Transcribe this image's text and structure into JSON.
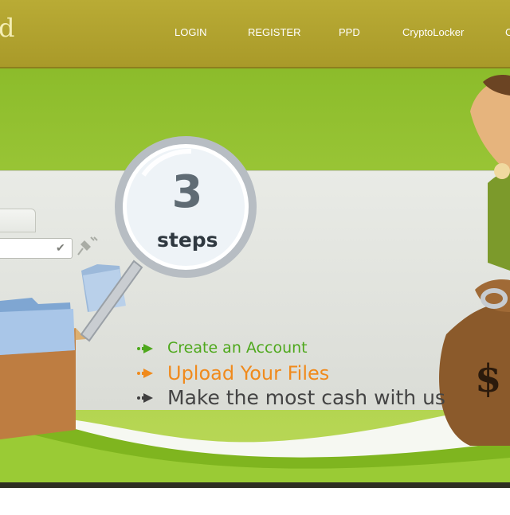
{
  "header": {
    "logo_text": "d",
    "nav": [
      {
        "label": "LOGIN"
      },
      {
        "label": "REGISTER"
      },
      {
        "label": "PPD"
      },
      {
        "label": "CryptoLocker"
      },
      {
        "label": "C"
      }
    ]
  },
  "hero": {
    "badge_number": "3",
    "badge_word": "steps",
    "steps": [
      {
        "text": "Create an Account",
        "color": "#4ea81c"
      },
      {
        "text": "Upload Your Files",
        "color": "#f08a1c"
      },
      {
        "text": "Make the most cash with us",
        "color": "#444444"
      }
    ],
    "bag_symbol": "$"
  },
  "colors": {
    "header": "#b0a22f",
    "hero_green": "#9cc838",
    "accent_orange": "#f08a1c"
  }
}
